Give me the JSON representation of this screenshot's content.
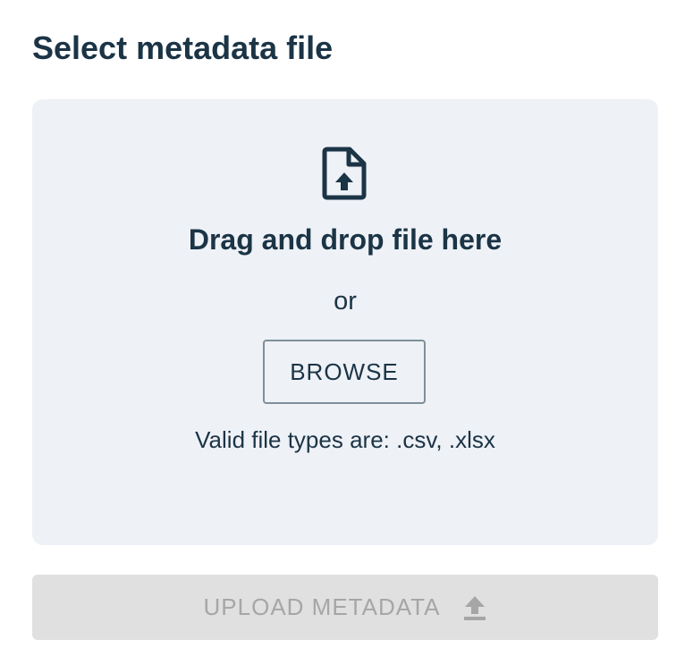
{
  "title": "Select metadata file",
  "dropzone": {
    "icon": "file-upload-icon",
    "heading": "Drag and drop file here",
    "or_text": "or",
    "browse_label": "BROWSE",
    "hint": "Valid file types are: .csv, .xlsx"
  },
  "upload_button": {
    "label": "UPLOAD METADATA",
    "icon": "upload-icon",
    "state": "disabled"
  },
  "colors": {
    "text_primary": "#1b3446",
    "dropzone_bg": "#eef1f6",
    "disabled_bg": "#e0e0e0",
    "disabled_text": "#a6a6a6"
  }
}
